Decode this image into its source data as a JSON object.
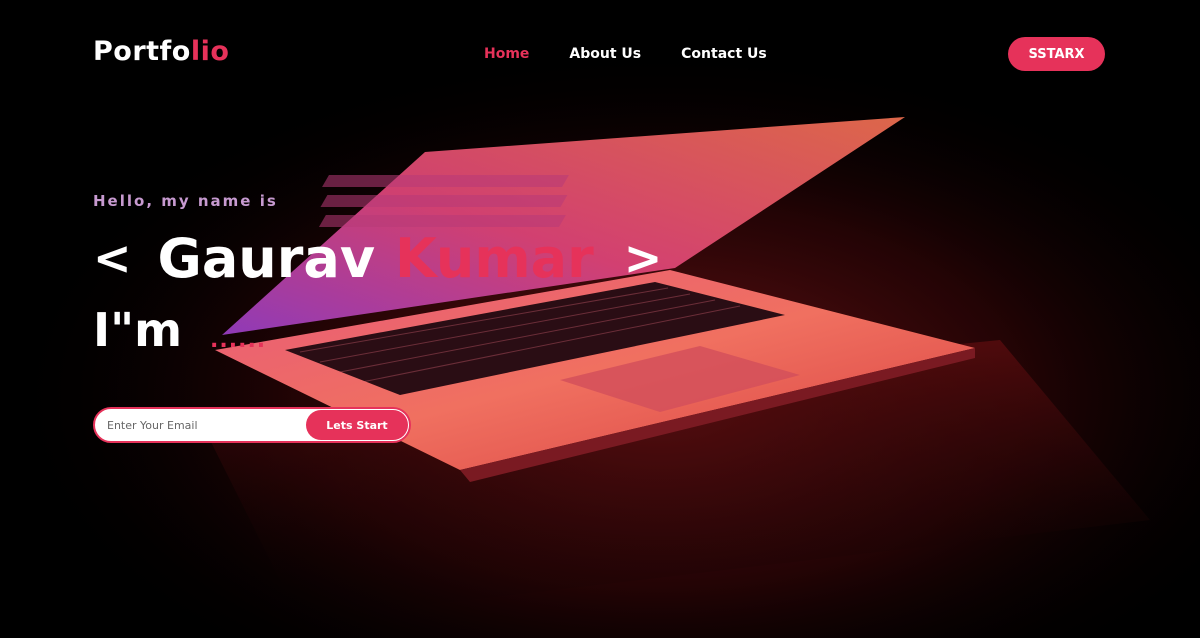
{
  "brand": {
    "name_main": "Portfo",
    "name_accent": "lio"
  },
  "nav": {
    "home": "Home",
    "about": "About Us",
    "contact": "Contact Us"
  },
  "cta_label": "SSTARX",
  "hero": {
    "greeting": "Hello, my name is",
    "bracket_open": "<",
    "first_name": "Gaurav",
    "last_name": "Kumar",
    "bracket_close": ">",
    "im_text": "I\"m",
    "dots": "......"
  },
  "signup": {
    "placeholder": "Enter Your Email",
    "button_label": "Lets Start"
  },
  "colors": {
    "accent": "#e6325a",
    "background": "#000000",
    "greeting": "#c79ad0"
  },
  "icons": {
    "background": "laptop-illustration"
  }
}
